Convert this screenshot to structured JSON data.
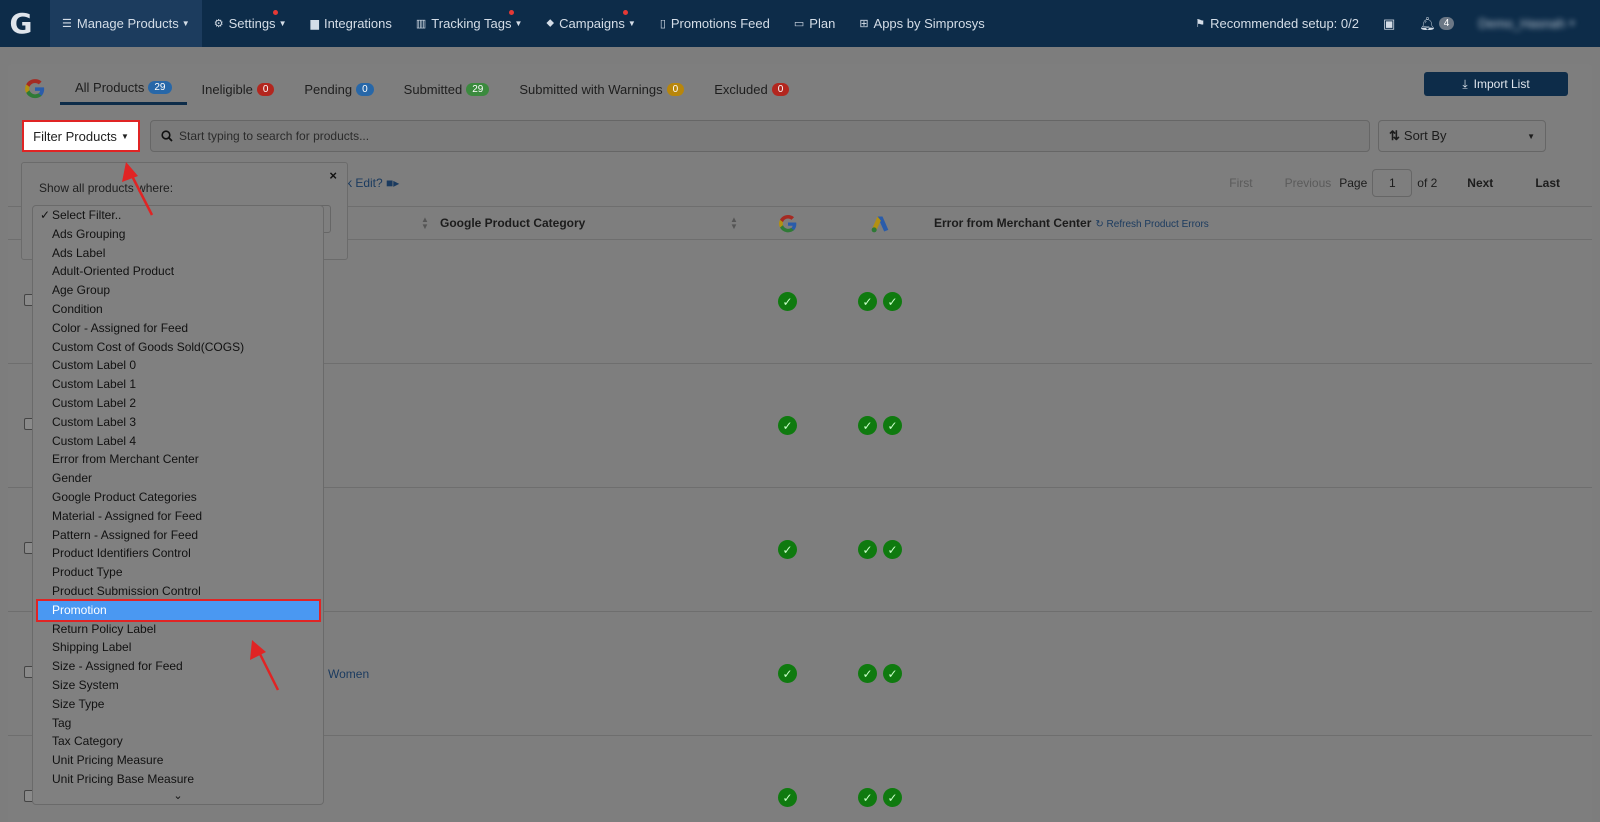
{
  "nav": {
    "logo": "G",
    "items": [
      {
        "label": "Manage Products",
        "icon": "list-icon",
        "caret": true,
        "dot": false,
        "active": true
      },
      {
        "label": "Settings",
        "icon": "gear-icon",
        "caret": true,
        "dot": true,
        "active": false
      },
      {
        "label": "Integrations",
        "icon": "briefcase-icon",
        "caret": false,
        "dot": false,
        "active": false
      },
      {
        "label": "Tracking Tags",
        "icon": "bar-chart-icon",
        "caret": true,
        "dot": true,
        "active": false
      },
      {
        "label": "Campaigns",
        "icon": "tag-icon",
        "caret": true,
        "dot": true,
        "active": false
      },
      {
        "label": "Promotions Feed",
        "icon": "file-icon",
        "caret": false,
        "dot": false,
        "active": false
      },
      {
        "label": "Plan",
        "icon": "credit-card-icon",
        "caret": false,
        "dot": false,
        "active": false
      },
      {
        "label": "Apps by Simprosys",
        "icon": "grid-icon",
        "caret": false,
        "dot": false,
        "active": false
      }
    ],
    "recommended": "Recommended setup: 0/2",
    "notifications": "4",
    "user": "Demo_Hasnah"
  },
  "tabs": [
    {
      "label": "All Products",
      "count": "29",
      "color": "#2767a8"
    },
    {
      "label": "Ineligible",
      "count": "0",
      "color": "#b3261e"
    },
    {
      "label": "Pending",
      "count": "0",
      "color": "#2767a8"
    },
    {
      "label": "Submitted",
      "count": "29",
      "color": "#3b8a3e"
    },
    {
      "label": "Submitted with Warnings",
      "count": "0",
      "color": "#b8860b"
    },
    {
      "label": "Excluded",
      "count": "0",
      "color": "#b3261e"
    }
  ],
  "toolbar": {
    "import_label": "Import List",
    "filter_label": "Filter Products",
    "search_placeholder": "Start typing to search for products...",
    "sort_label": "Sort By",
    "bulk_edit": "k Edit?"
  },
  "pager": {
    "first": "First",
    "previous": "Previous",
    "page_label": "Page",
    "page": "1",
    "of": "of 2",
    "next": "Next",
    "last": "Last"
  },
  "table": {
    "col_category": "Google Product Category",
    "col_error": "Error from Merchant Center",
    "refresh": "Refresh Product Errors",
    "row_link": "Women"
  },
  "filter_popup": {
    "label": "Show all products where:",
    "close": "×"
  },
  "dropdown": {
    "selected_index": 21,
    "options": [
      "Select Filter..",
      "Ads Grouping",
      "Ads Label",
      "Adult-Oriented Product",
      "Age Group",
      "Condition",
      "Color - Assigned for Feed",
      "Custom Cost of Goods Sold(COGS)",
      "Custom Label 0",
      "Custom Label 1",
      "Custom Label 2",
      "Custom Label 3",
      "Custom Label 4",
      "Error from Merchant Center",
      "Gender",
      "Google Product Categories",
      "Material - Assigned for Feed",
      "Pattern - Assigned for Feed",
      "Product Identifiers Control",
      "Product Type",
      "Product Submission Control",
      "Promotion",
      "Return Policy Label",
      "Shipping Label",
      "Size - Assigned for Feed",
      "Size System",
      "Size Type",
      "Tag",
      "Tax Category",
      "Unit Pricing Measure",
      "Unit Pricing Base Measure"
    ]
  }
}
